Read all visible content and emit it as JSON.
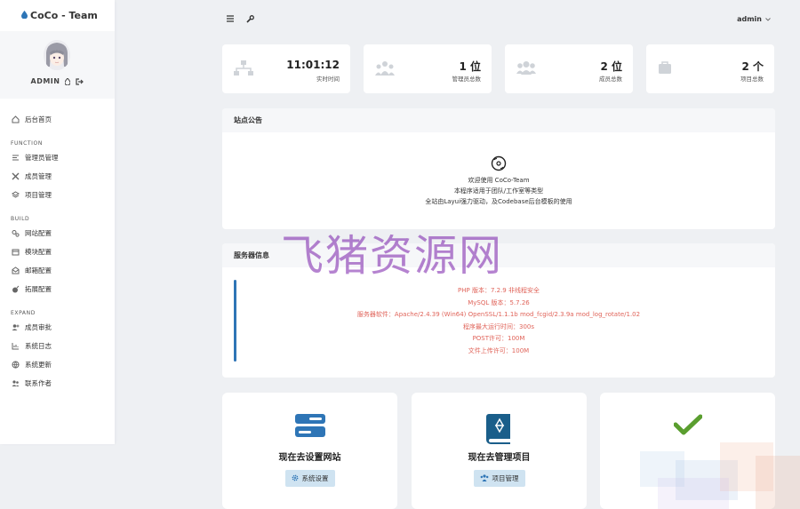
{
  "app": {
    "brand": "CoCo - Team"
  },
  "profile": {
    "name": "ADMIN"
  },
  "sidebar": {
    "home": "后台首页",
    "sections": [
      {
        "heading": "FUNCTION",
        "items": [
          "管理员管理",
          "成员管理",
          "项目管理"
        ]
      },
      {
        "heading": "BUILD",
        "items": [
          "网站配置",
          "模块配置",
          "邮箱配置",
          "拓展配置"
        ]
      },
      {
        "heading": "EXPAND",
        "items": [
          "成员审批",
          "系统日志",
          "系统更新",
          "联系作者"
        ]
      }
    ]
  },
  "topbar": {
    "user": "admin"
  },
  "stats": [
    {
      "value": "11:01:12",
      "label": "实时时间",
      "icon": "sitemap-icon"
    },
    {
      "value": "1 位",
      "label": "管理员总数",
      "icon": "users-icon"
    },
    {
      "value": "2 位",
      "label": "成员总数",
      "icon": "group-icon"
    },
    {
      "value": "2 个",
      "label": "项目总数",
      "icon": "briefcase-icon"
    }
  ],
  "notice": {
    "title": "站点公告",
    "lines": [
      "欢迎使用 CoCo-Team",
      "本程序适用于团队/工作室等类型",
      "全站由Layui强力驱动，及Codebase后台模板的使用"
    ]
  },
  "server": {
    "title": "服务器信息",
    "lines": [
      "PHP 版本：7.2.9 非线程安全",
      "MySQL 版本：5.7.26",
      "服务器软件：Apache/2.4.39 (Win64) OpenSSL/1.1.1b mod_fcgid/2.3.9a mod_log_rotate/1.02",
      "程序最大运行时间：300s",
      "POST许可：100M",
      "文件上传许可：100M"
    ]
  },
  "cards": [
    {
      "title": "现在去设置网站",
      "button": "系统设置"
    },
    {
      "title": "现在去管理项目",
      "button": "项目管理"
    }
  ],
  "watermark": "飞猪资源网",
  "colors": {
    "accent": "#2e75b6",
    "server_text": "#e0645a",
    "button_bg": "#cfe3f1",
    "check": "#5a9e2f"
  }
}
